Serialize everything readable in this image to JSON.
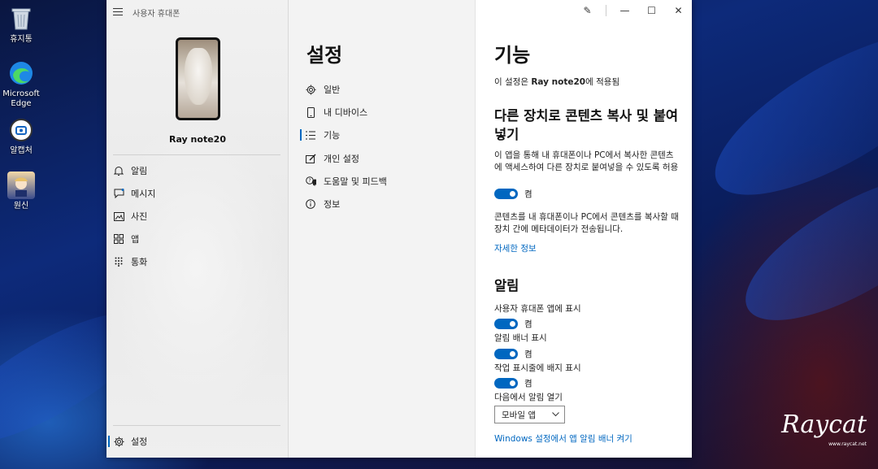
{
  "desktop": {
    "icons": [
      {
        "label": "휴지통",
        "icon": "recycle-bin-icon"
      },
      {
        "label": "Microsoft Edge",
        "icon": "edge-icon"
      },
      {
        "label": "알캡처",
        "icon": "alcapture-icon"
      },
      {
        "label": "원신",
        "icon": "genshin-icon"
      }
    ],
    "watermark": "Raycat",
    "watermark_url": "www.raycat.net"
  },
  "window": {
    "app_title": "사용자 휴대폰",
    "device_name": "Ray note20",
    "left_nav": [
      {
        "label": "알림",
        "icon": "bell-icon"
      },
      {
        "label": "메시지",
        "icon": "message-icon"
      },
      {
        "label": "사진",
        "icon": "photo-icon"
      },
      {
        "label": "앱",
        "icon": "apps-icon"
      },
      {
        "label": "통화",
        "icon": "dialpad-icon"
      }
    ],
    "settings_label": "설정",
    "settings_panel": {
      "title": "설정",
      "items": [
        {
          "label": "일반",
          "icon": "gear-icon"
        },
        {
          "label": "내 디바이스",
          "icon": "phone-icon"
        },
        {
          "label": "기능",
          "icon": "list-icon",
          "active": true
        },
        {
          "label": "개인 설정",
          "icon": "paint-icon"
        },
        {
          "label": "도움말 및 피드백",
          "icon": "chat-icon"
        },
        {
          "label": "정보",
          "icon": "info-icon"
        }
      ]
    },
    "titlebar": {
      "pen": "✎",
      "minimize": "—",
      "maximize": "☐",
      "close": "✕"
    },
    "features": {
      "title": "기능",
      "applied_prefix": "이 설정은 ",
      "applied_device": "Ray note20",
      "applied_suffix": "에 적용됨",
      "copy_heading": "다른 장치로 콘텐츠 복사 및 붙여넣기",
      "copy_desc": "이 앱을 통해 내 휴대폰이나 PC에서 복사한 콘텐츠에 액세스하여 다른 장치로 붙여넣을 수 있도록 허용",
      "copy_toggle": "켬",
      "copy_desc2": "콘텐츠를 내 휴대폰이나 PC에서 콘텐츠를 복사할 때 장치 간에 메타데이터가 전송됩니다.",
      "more_info_link": "자세한 정보",
      "notif_heading": "알림",
      "notif_show_in_app": "사용자 휴대폰 앱에 표시",
      "notif_show_in_app_toggle": "켬",
      "notif_banner": "알림 배너 표시",
      "notif_banner_toggle": "켬",
      "notif_badge": "작업 표시줄에 배지 표시",
      "notif_badge_toggle": "켬",
      "open_in_label": "다음에서 알림 열기",
      "open_in_value": "모바일 앱",
      "windows_link": "Windows 설정에서 앱 알림 배너 켜기"
    }
  },
  "colors": {
    "accent": "#0067c0"
  }
}
